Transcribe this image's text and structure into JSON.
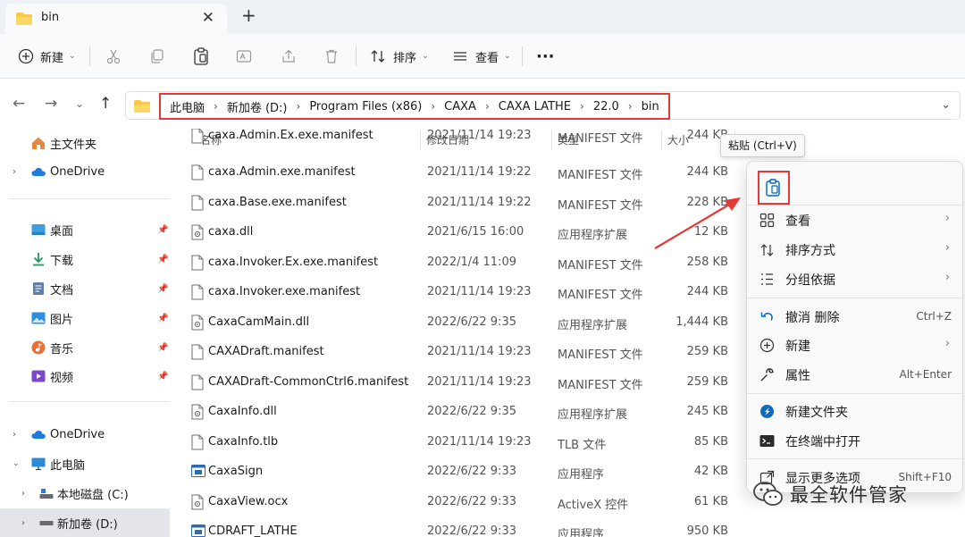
{
  "tab": {
    "title": "bin",
    "close": "✕",
    "new_tab": "+"
  },
  "toolbar": {
    "new_label": "新建",
    "sort_label": "排序",
    "view_label": "查看",
    "more_label": "···"
  },
  "address": {
    "crumbs": [
      "此电脑",
      "新加卷 (D:)",
      "Program Files (x86)",
      "CAXA",
      "CAXA LATHE",
      "22.0",
      "bin"
    ]
  },
  "sidebar": {
    "home": "主文件夹",
    "onedrive1": "OneDrive",
    "desktop": "桌面",
    "downloads": "下载",
    "documents": "文档",
    "pictures": "图片",
    "music": "音乐",
    "videos": "视频",
    "onedrive2": "OneDrive",
    "thispc": "此电脑",
    "local_c": "本地磁盘 (C:)",
    "vol_d": "新加卷 (D:)"
  },
  "columns": {
    "name": "名称",
    "date": "修改日期",
    "type": "类型",
    "size": "大小"
  },
  "files": [
    {
      "name": "caxa.Admin.Ex.exe.manifest",
      "date": "2021/11/14 19:23",
      "type": "MANIFEST 文件",
      "size": "244 KB",
      "icon": "file"
    },
    {
      "name": "caxa.Admin.exe.manifest",
      "date": "2021/11/14 19:22",
      "type": "MANIFEST 文件",
      "size": "244 KB",
      "icon": "file"
    },
    {
      "name": "caxa.Base.exe.manifest",
      "date": "2021/11/14 19:22",
      "type": "MANIFEST 文件",
      "size": "228 KB",
      "icon": "file"
    },
    {
      "name": "caxa.dll",
      "date": "2021/6/15 16:00",
      "type": "应用程序扩展",
      "size": "12 KB",
      "icon": "dll"
    },
    {
      "name": "caxa.Invoker.Ex.exe.manifest",
      "date": "2022/1/4 11:09",
      "type": "MANIFEST 文件",
      "size": "258 KB",
      "icon": "file"
    },
    {
      "name": "caxa.Invoker.exe.manifest",
      "date": "2021/11/14 19:23",
      "type": "MANIFEST 文件",
      "size": "244 KB",
      "icon": "file"
    },
    {
      "name": "CaxaCamMain.dll",
      "date": "2022/6/22 9:35",
      "type": "应用程序扩展",
      "size": "1,444 KB",
      "icon": "dll"
    },
    {
      "name": "CAXADraft.manifest",
      "date": "2021/11/14 19:23",
      "type": "MANIFEST 文件",
      "size": "259 KB",
      "icon": "file"
    },
    {
      "name": "CAXADraft-CommonCtrl6.manifest",
      "date": "2021/11/14 19:23",
      "type": "MANIFEST 文件",
      "size": "259 KB",
      "icon": "file"
    },
    {
      "name": "CaxaInfo.dll",
      "date": "2022/6/22 9:35",
      "type": "应用程序扩展",
      "size": "245 KB",
      "icon": "dll"
    },
    {
      "name": "CaxaInfo.tlb",
      "date": "2021/11/14 19:23",
      "type": "TLB 文件",
      "size": "85 KB",
      "icon": "file"
    },
    {
      "name": "CaxaSign",
      "date": "2022/6/22 9:33",
      "type": "应用程序",
      "size": "42 KB",
      "icon": "exe"
    },
    {
      "name": "CaxaView.ocx",
      "date": "2022/6/22 9:33",
      "type": "ActiveX 控件",
      "size": "61 KB",
      "icon": "dll"
    },
    {
      "name": "CDRAFT_LATHE",
      "date": "2022/6/22 9:33",
      "type": "应用程序",
      "size": "950 KB",
      "icon": "exe"
    }
  ],
  "tooltip": "粘贴 (Ctrl+V)",
  "context_menu": {
    "view": "查看",
    "sort": "排序方式",
    "group": "分组依据",
    "undo": "撤消 删除",
    "undo_shortcut": "Ctrl+Z",
    "new": "新建",
    "properties": "属性",
    "properties_shortcut": "Alt+Enter",
    "new_folder": "新建文件夹",
    "terminal": "在终端中打开",
    "more": "显示更多选项",
    "more_shortcut": "Shift+F10"
  },
  "watermark": "最全软件管家",
  "colors": {
    "accent": "#0067c0",
    "highlight": "#e53935",
    "folder": "#f8c948"
  }
}
